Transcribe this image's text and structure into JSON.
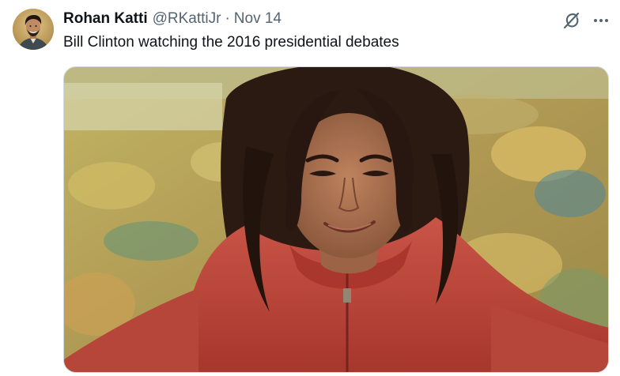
{
  "tweet": {
    "author": {
      "display_name": "Rohan Katti",
      "handle": "@RKattiJr",
      "avatar": "avatar"
    },
    "separator": "·",
    "timestamp": "Nov 14",
    "text": "Bill Clinton watching the 2016 presidential debates",
    "actions": {
      "grok_icon": "grok-icon",
      "more_icon": "more-dots-icon"
    },
    "media": {
      "type": "photo",
      "description_icon": "photo"
    }
  },
  "colors": {
    "text_primary": "#0f1419",
    "text_secondary": "#536471",
    "border": "#cfd9de",
    "photo_hoodie": "#c94b3f"
  }
}
